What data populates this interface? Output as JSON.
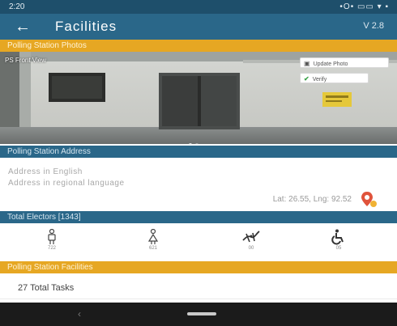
{
  "status_bar": {
    "time": "2:20",
    "icons": "•O• ▭▭ ▾ ▪"
  },
  "app_bar": {
    "back_icon": "back-arrow-icon",
    "title": "Facilities",
    "version": "V 2.8"
  },
  "photos": {
    "header": "Polling Station Photos",
    "photo_label": "PS Front View",
    "update_photo_label": "Update Photo",
    "verify_label": "Verify"
  },
  "address": {
    "header": "Polling Station Address",
    "english": "Address in English",
    "regional": "Address in regional language",
    "latlng": "Lat: 26.55, Lng: 92.52"
  },
  "electors": {
    "header": "Total Electors [1343]",
    "items": [
      {
        "icon": "male-voter-icon",
        "count": "722"
      },
      {
        "icon": "female-voter-icon",
        "count": "621"
      },
      {
        "icon": "third-gender-icon",
        "count": "00"
      },
      {
        "icon": "wheelchair-icon",
        "count": "05"
      }
    ]
  },
  "facilities": {
    "header": "Polling Station Facilities",
    "tasks": "27 Total Tasks"
  },
  "colors": {
    "primary": "#2a6789",
    "accent": "#e6a723",
    "status": "#1e4f6b"
  }
}
